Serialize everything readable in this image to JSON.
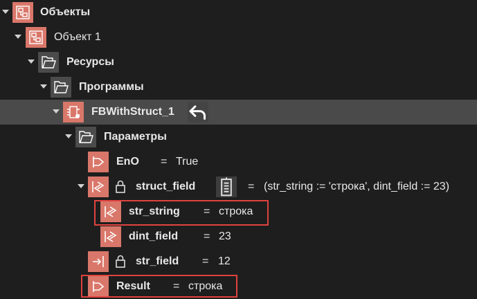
{
  "tree": {
    "objects": {
      "label": "Объекты"
    },
    "object1": {
      "label": "Объект 1"
    },
    "resources": {
      "label": "Ресурсы"
    },
    "programs": {
      "label": "Программы"
    },
    "fb": {
      "label": "FBWithStruct_1",
      "action_icon": "undo-arrow-icon"
    },
    "params": {
      "label": "Параметры"
    },
    "eno": {
      "label": "EnO",
      "eq": "=",
      "value": "True"
    },
    "struct_field": {
      "label": "struct_field",
      "eq": "=",
      "value": "(str_string := 'строка', dint_field := 23)",
      "extra_icon": "struct-details-icon"
    },
    "str_string": {
      "label": "str_string",
      "eq": "=",
      "value": "строка"
    },
    "dint_field": {
      "label": "dint_field",
      "eq": "=",
      "value": "23"
    },
    "str_field": {
      "label": "str_field",
      "eq": "=",
      "value": "12"
    },
    "result": {
      "label": "Result",
      "eq": "=",
      "value": "строка"
    }
  },
  "colors": {
    "accent_orange": "#d9776a",
    "highlight_red": "#e0433f",
    "selected_row": "#4a4a4a",
    "background": "#1e1e1e"
  }
}
